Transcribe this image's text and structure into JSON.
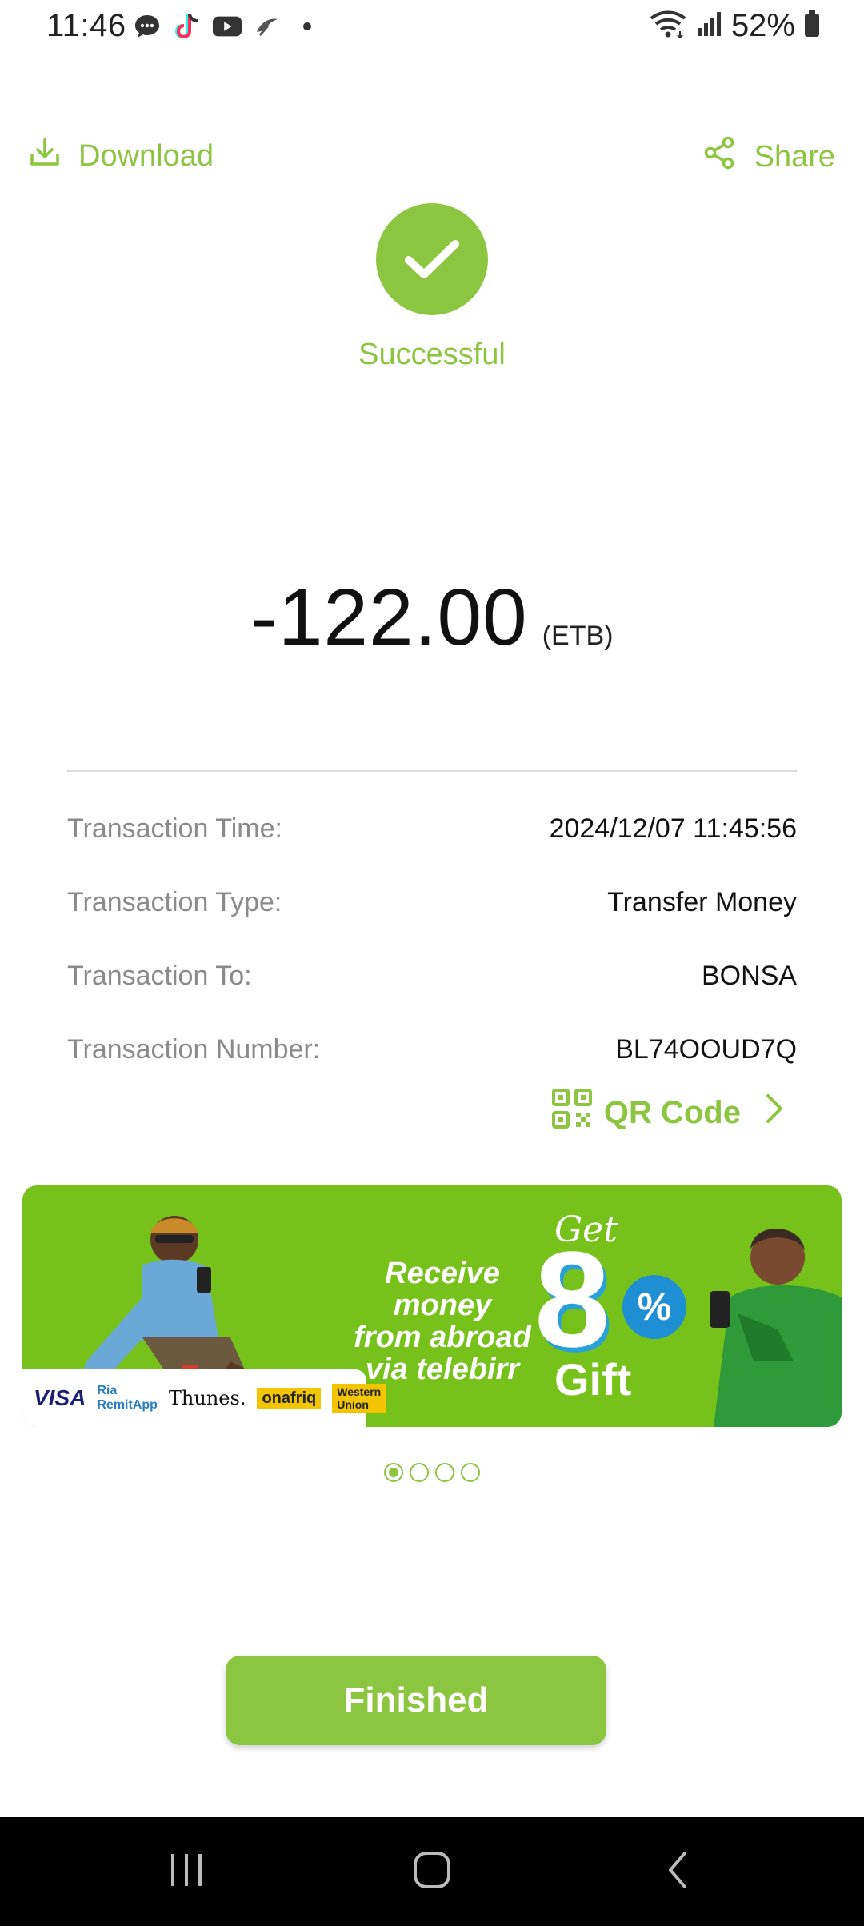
{
  "status_bar": {
    "time": "11:46",
    "battery": "52%",
    "left_icons": [
      "messages-icon",
      "tiktok-icon",
      "youtube-icon",
      "app-icon",
      "dot-icon"
    ],
    "right_icons": [
      "wifi-icon",
      "signal-icon",
      "battery-icon"
    ]
  },
  "header": {
    "download_label": "Download",
    "share_label": "Share"
  },
  "result": {
    "status": "Successful",
    "amount": "-122.00",
    "currency": "(ETB)"
  },
  "details": [
    {
      "label": "Transaction Time:",
      "value": "2024/12/07 11:45:56"
    },
    {
      "label": "Transaction Type:",
      "value": "Transfer Money"
    },
    {
      "label": "Transaction To:",
      "value": "BONSA"
    },
    {
      "label": "Transaction Number:",
      "value": "BL74OOUD7Q"
    }
  ],
  "qr": {
    "label": "QR Code"
  },
  "banner": {
    "line1": "Receive money",
    "line2": "from abroad",
    "line3": "via telebirr",
    "get": "Get",
    "number": "8",
    "percent": "%",
    "gift": "Gift",
    "partners": [
      "VISA",
      "Ria RemitApp",
      "Thunes.",
      "onafriq",
      "Western Union"
    ],
    "page_count": 4,
    "active_page": 1
  },
  "actions": {
    "finished_label": "Finished"
  },
  "colors": {
    "accent": "#8cc53f",
    "banner_bg": "#76c21a",
    "nav_bg": "#000000"
  }
}
